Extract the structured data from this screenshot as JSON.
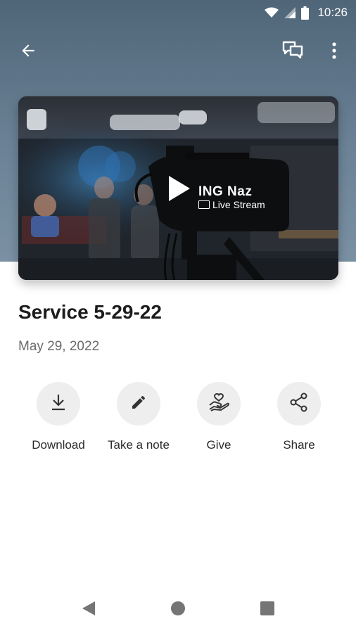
{
  "status_bar": {
    "time": "10:26",
    "icons": [
      "wifi-icon",
      "cell-signal-icon",
      "battery-icon"
    ]
  },
  "app_bar": {
    "back_icon": "arrow-back-icon",
    "chat_icon": "chat-icon",
    "more_icon": "more-vert-icon"
  },
  "video": {
    "brand_text": "ING Naz",
    "subtitle": "Live Stream",
    "play_icon": "play-icon"
  },
  "media": {
    "title": "Service 5-29-22",
    "date": "May 29, 2022"
  },
  "actions": [
    {
      "label": "Download",
      "icon": "download-icon"
    },
    {
      "label": "Take a note",
      "icon": "pencil-icon"
    },
    {
      "label": "Give",
      "icon": "give-hand-heart-icon"
    },
    {
      "label": "Share",
      "icon": "share-icon"
    }
  ],
  "nav": {
    "back": "nav-back-icon",
    "home": "nav-home-icon",
    "recents": "nav-recents-icon"
  },
  "colors": {
    "header": "#5f768a",
    "action_circle": "#eeeeee",
    "title_text": "#1c1c1c",
    "date_text": "#6b6b6b"
  }
}
